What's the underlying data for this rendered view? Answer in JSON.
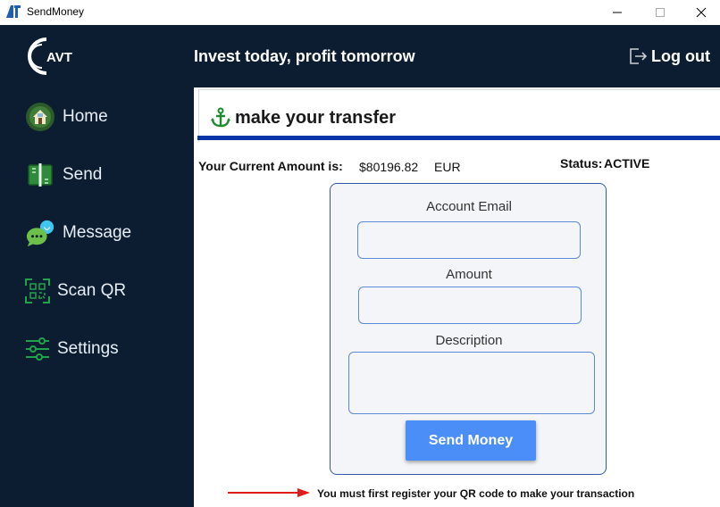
{
  "window": {
    "title": "SendMoney",
    "icon": "avt-app-icon",
    "controls": [
      "minimize-icon",
      "maximize-icon",
      "close-icon"
    ]
  },
  "sidebar": {
    "logo_text": "AVT",
    "items": [
      {
        "label": "Home",
        "icon": "home-icon"
      },
      {
        "label": "Send",
        "icon": "send-icon"
      },
      {
        "label": "Message",
        "icon": "message-icon"
      },
      {
        "label": "Scan QR",
        "icon": "qr-scan-icon"
      },
      {
        "label": "Settings",
        "icon": "settings-icon"
      }
    ]
  },
  "header": {
    "tagline": "Invest today, profit tomorrow",
    "logout_label": "Log out"
  },
  "page": {
    "title": "make your transfer",
    "amount_label": "Your Current Amount is:",
    "amount_value": "$80196.82",
    "amount_currency": "EUR",
    "status_label": "Status:",
    "status_value": "ACTIVE"
  },
  "form": {
    "email_label": "Account Email",
    "email_value": "",
    "amount_label": "Amount",
    "amount_value": "",
    "description_label": "Description",
    "description_value": "",
    "submit_label": "Send Money"
  },
  "notice": "You must first register your QR code to make your transaction",
  "colors": {
    "sidebar_bg": "#0c1d31",
    "accent_blue": "#0a35a8",
    "button_blue": "#4c8ef7",
    "icon_green": "#1fa34a",
    "arrow_red": "#e01b1b"
  }
}
